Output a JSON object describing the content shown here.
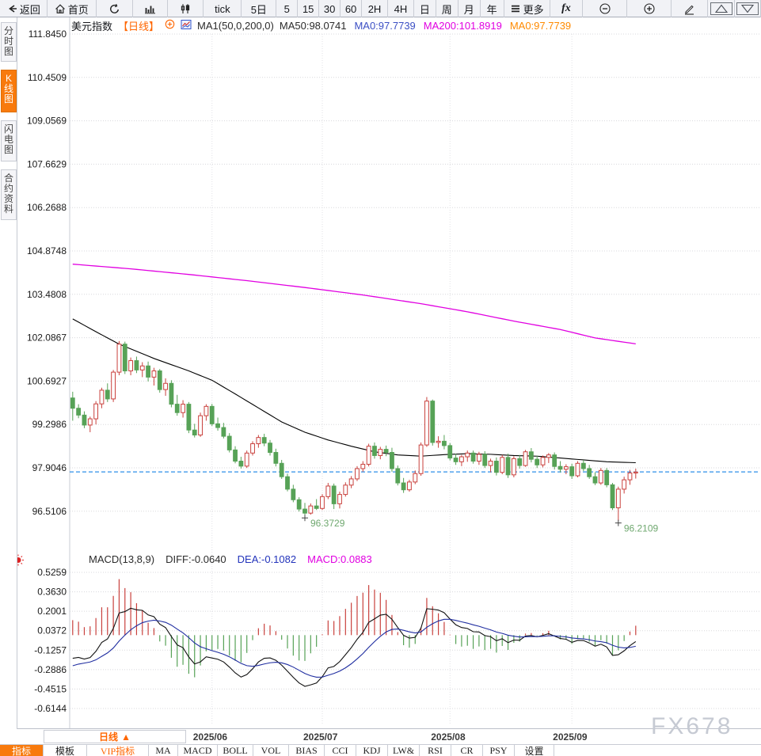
{
  "toolbar": {
    "items": [
      {
        "id": "back",
        "label": "返回",
        "icon": "back"
      },
      {
        "id": "home",
        "label": "首页",
        "icon": "home"
      },
      {
        "id": "refresh",
        "label": "",
        "icon": "refresh"
      },
      {
        "id": "line-chart",
        "label": "",
        "icon": "bar-chart"
      },
      {
        "id": "candle-chart",
        "label": "",
        "icon": "candle"
      },
      {
        "id": "tick",
        "label": "tick",
        "icon": ""
      },
      {
        "id": "5d",
        "label": "5日",
        "icon": ""
      },
      {
        "id": "m5",
        "label": "5",
        "icon": ""
      },
      {
        "id": "m15",
        "label": "15",
        "icon": ""
      },
      {
        "id": "m30",
        "label": "30",
        "icon": ""
      },
      {
        "id": "m60",
        "label": "60",
        "icon": ""
      },
      {
        "id": "h2",
        "label": "2H",
        "icon": ""
      },
      {
        "id": "h4",
        "label": "4H",
        "icon": ""
      },
      {
        "id": "day",
        "label": "日",
        "icon": ""
      },
      {
        "id": "week",
        "label": "周",
        "icon": ""
      },
      {
        "id": "month",
        "label": "月",
        "icon": ""
      },
      {
        "id": "year",
        "label": "年",
        "icon": ""
      },
      {
        "id": "more",
        "label": "更多",
        "icon": "menu"
      },
      {
        "id": "fx",
        "label": "fx",
        "icon": ""
      },
      {
        "id": "zoom-out",
        "label": "",
        "icon": "zoom-out"
      },
      {
        "id": "zoom-in",
        "label": "",
        "icon": "zoom-in"
      },
      {
        "id": "draw",
        "label": "",
        "icon": "pencil"
      },
      {
        "id": "panel-up",
        "label": "",
        "icon": "tri-up"
      },
      {
        "id": "panel-down",
        "label": "",
        "icon": "tri-down"
      }
    ]
  },
  "sidebar": {
    "items": [
      {
        "id": "time-share-chart",
        "label": "分时图",
        "active": false
      },
      {
        "id": "candlestick-chart",
        "label": "K线图",
        "active": true
      },
      {
        "id": "lightning-chart",
        "label": "闪电图",
        "active": false
      },
      {
        "id": "contract-info",
        "label": "合约资料",
        "active": false
      }
    ]
  },
  "chart_header": {
    "symbol": "美元指数",
    "period_tag": "【日线】",
    "ma_settings": "MA1(50,0,200,0)",
    "ma_values": [
      {
        "label": "MA50:98.0741",
        "color": "#2b2b2b"
      },
      {
        "label": "MA0:97.7739",
        "color": "#3b4fc4"
      },
      {
        "label": "MA200:101.8919",
        "color": "#e100e1"
      },
      {
        "label": "MA0:97.7739",
        "color": "#ff8a00"
      }
    ]
  },
  "macd_header": {
    "title": "MACD(13,8,9)",
    "values": [
      {
        "label": "DIFF:-0.0640",
        "color": "#2b2b2b"
      },
      {
        "label": "DEA:-0.1082",
        "color": "#2233bb"
      },
      {
        "label": "MACD:0.0883",
        "color": "#e100e1"
      }
    ]
  },
  "xaxis": {
    "period_label": "日线",
    "period_arrow": "▲"
  },
  "bottom_tabs": [
    {
      "id": "indicators",
      "label": "指标",
      "active": true,
      "vip": false
    },
    {
      "id": "templates",
      "label": "模板",
      "active": false,
      "vip": false
    },
    {
      "id": "vip-indicators",
      "label": "VIP指标",
      "active": false,
      "vip": true
    },
    {
      "id": "ma",
      "label": "MA",
      "active": false,
      "vip": false
    },
    {
      "id": "macd",
      "label": "MACD",
      "active": false,
      "vip": false
    },
    {
      "id": "boll",
      "label": "BOLL",
      "active": false,
      "vip": false
    },
    {
      "id": "vol",
      "label": "VOL",
      "active": false,
      "vip": false
    },
    {
      "id": "bias",
      "label": "BIAS",
      "active": false,
      "vip": false
    },
    {
      "id": "cci",
      "label": "CCI",
      "active": false,
      "vip": false
    },
    {
      "id": "kdj",
      "label": "KDJ",
      "active": false,
      "vip": false
    },
    {
      "id": "lwr",
      "label": "LW&",
      "active": false,
      "vip": false
    },
    {
      "id": "rsi",
      "label": "RSI",
      "active": false,
      "vip": false
    },
    {
      "id": "cr",
      "label": "CR",
      "active": false,
      "vip": false
    },
    {
      "id": "psy",
      "label": "PSY",
      "active": false,
      "vip": false
    },
    {
      "id": "settings",
      "label": "设置",
      "active": false,
      "vip": false
    }
  ],
  "watermark": "FX678",
  "chart_data": {
    "type": "candlestick",
    "title": "美元指数 日线",
    "y_axis": {
      "labels": [
        "111.8450",
        "110.4509",
        "109.0569",
        "107.6629",
        "106.2688",
        "104.8748",
        "103.4808",
        "102.0867",
        "100.6927",
        "99.2986",
        "97.9046",
        "96.5106"
      ]
    },
    "macd_axis": {
      "labels": [
        "0.5259",
        "0.3630",
        "0.2001",
        "0.0372",
        "-0.1257",
        "-0.2886",
        "-0.4515",
        "-0.6144"
      ]
    },
    "x_labels": [
      {
        "label": "2025/06",
        "index": 24
      },
      {
        "label": "2025/07",
        "index": 43
      },
      {
        "label": "2025/08",
        "index": 65
      },
      {
        "label": "2025/09",
        "index": 86
      }
    ],
    "current_price": 97.7739,
    "annotations": [
      {
        "index": 40,
        "price": 96.3729,
        "label": "96.3729"
      },
      {
        "index": 94,
        "price": 96.2109,
        "label": "96.2109"
      }
    ],
    "colors": {
      "up": "#c9413d",
      "down": "#57a257",
      "ma50": "#000000",
      "ma200": "#e100e1",
      "diff": "#111111",
      "dea": "#1f2da0",
      "current": "#2e8fe8",
      "annotation": "#6fa86f",
      "grid": "#d8d8dc",
      "axis_text": "#1a1a1a"
    },
    "ohlc_format": [
      "open",
      "high",
      "low",
      "close"
    ],
    "candles": [
      [
        100.15,
        100.35,
        99.42,
        99.82
      ],
      [
        99.82,
        99.95,
        99.5,
        99.6
      ],
      [
        99.6,
        99.72,
        99.18,
        99.28
      ],
      [
        99.28,
        99.55,
        99.05,
        99.48
      ],
      [
        99.48,
        100.05,
        99.3,
        99.96
      ],
      [
        99.96,
        100.48,
        99.82,
        100.4
      ],
      [
        100.4,
        100.62,
        100.02,
        100.12
      ],
      [
        100.12,
        101.05,
        100.02,
        100.98
      ],
      [
        100.98,
        101.98,
        100.88,
        101.88
      ],
      [
        101.88,
        101.96,
        100.92,
        101.02
      ],
      [
        101.02,
        101.45,
        100.88,
        101.35
      ],
      [
        101.35,
        101.48,
        100.95,
        101.05
      ],
      [
        101.05,
        101.3,
        100.82,
        101.18
      ],
      [
        101.18,
        101.32,
        100.68,
        100.82
      ],
      [
        100.82,
        101.12,
        100.55,
        101.02
      ],
      [
        101.02,
        101.08,
        100.32,
        100.42
      ],
      [
        100.42,
        100.78,
        100.22,
        100.62
      ],
      [
        100.62,
        100.72,
        99.85,
        99.95
      ],
      [
        99.95,
        100.25,
        99.58,
        99.68
      ],
      [
        99.68,
        100.08,
        99.52,
        99.95
      ],
      [
        99.95,
        100.02,
        99.02,
        99.12
      ],
      [
        99.12,
        99.32,
        98.88,
        98.96
      ],
      [
        98.96,
        99.68,
        98.9,
        99.58
      ],
      [
        99.58,
        99.95,
        99.42,
        99.88
      ],
      [
        99.88,
        99.96,
        99.25,
        99.32
      ],
      [
        99.32,
        99.52,
        99.1,
        99.2
      ],
      [
        99.2,
        99.35,
        98.85,
        98.92
      ],
      [
        98.92,
        99.02,
        98.4,
        98.48
      ],
      [
        98.48,
        98.6,
        98.05,
        98.12
      ],
      [
        98.12,
        98.26,
        97.88,
        97.96
      ],
      [
        97.96,
        98.46,
        97.9,
        98.38
      ],
      [
        98.38,
        98.76,
        98.3,
        98.68
      ],
      [
        98.68,
        98.96,
        98.55,
        98.88
      ],
      [
        98.88,
        99.0,
        98.6,
        98.7
      ],
      [
        98.7,
        98.8,
        98.3,
        98.4
      ],
      [
        98.4,
        98.52,
        97.95,
        98.05
      ],
      [
        98.05,
        98.16,
        97.55,
        97.62
      ],
      [
        97.62,
        97.72,
        97.15,
        97.22
      ],
      [
        97.22,
        97.36,
        96.8,
        96.88
      ],
      [
        96.88,
        96.96,
        96.5,
        96.58
      ],
      [
        96.58,
        96.78,
        96.3729,
        96.45
      ],
      [
        96.45,
        96.76,
        96.4,
        96.68
      ],
      [
        96.68,
        96.9,
        96.55,
        96.6
      ],
      [
        96.6,
        97.06,
        96.55,
        96.98
      ],
      [
        96.98,
        97.42,
        96.9,
        97.32
      ],
      [
        97.32,
        97.4,
        96.58,
        96.75
      ],
      [
        96.75,
        97.14,
        96.6,
        97.05
      ],
      [
        97.05,
        97.44,
        96.98,
        97.35
      ],
      [
        97.35,
        97.64,
        97.25,
        97.55
      ],
      [
        97.55,
        97.96,
        97.48,
        97.88
      ],
      [
        97.88,
        98.12,
        97.78,
        98.02
      ],
      [
        98.02,
        98.68,
        97.95,
        98.6
      ],
      [
        98.6,
        98.72,
        98.2,
        98.3
      ],
      [
        98.3,
        98.58,
        98.18,
        98.5
      ],
      [
        98.5,
        98.62,
        98.28,
        98.4
      ],
      [
        98.4,
        98.55,
        97.78,
        97.88
      ],
      [
        97.88,
        97.98,
        97.34,
        97.42
      ],
      [
        97.42,
        97.58,
        97.1,
        97.2
      ],
      [
        97.2,
        97.52,
        97.14,
        97.45
      ],
      [
        97.45,
        97.82,
        97.38,
        97.72
      ],
      [
        97.72,
        98.72,
        97.65,
        98.64
      ],
      [
        98.64,
        100.18,
        98.58,
        100.05
      ],
      [
        100.05,
        100.1,
        98.62,
        98.72
      ],
      [
        98.72,
        98.92,
        98.55,
        98.76
      ],
      [
        98.76,
        98.96,
        98.5,
        98.62
      ],
      [
        98.62,
        98.7,
        98.14,
        98.22
      ],
      [
        98.22,
        98.36,
        98.0,
        98.1
      ],
      [
        98.1,
        98.32,
        97.96,
        98.26
      ],
      [
        98.26,
        98.46,
        98.1,
        98.38
      ],
      [
        98.38,
        98.46,
        98.04,
        98.12
      ],
      [
        98.12,
        98.42,
        98.0,
        98.34
      ],
      [
        98.34,
        98.44,
        97.9,
        97.98
      ],
      [
        97.98,
        98.2,
        97.76,
        98.12
      ],
      [
        98.12,
        98.24,
        97.66,
        97.76
      ],
      [
        97.76,
        98.32,
        97.7,
        98.24
      ],
      [
        98.24,
        98.36,
        97.58,
        97.68
      ],
      [
        97.68,
        98.28,
        97.6,
        98.2
      ],
      [
        98.2,
        98.32,
        97.88,
        97.98
      ],
      [
        97.98,
        98.48,
        97.94,
        98.42
      ],
      [
        98.42,
        98.54,
        98.08,
        98.18
      ],
      [
        98.18,
        98.3,
        97.9,
        98.0
      ],
      [
        98.0,
        98.3,
        97.92,
        98.24
      ],
      [
        98.24,
        98.38,
        98.06,
        98.32
      ],
      [
        98.32,
        98.4,
        97.85,
        97.95
      ],
      [
        97.95,
        98.12,
        97.76,
        97.86
      ],
      [
        97.86,
        98.02,
        97.7,
        97.94
      ],
      [
        97.94,
        98.04,
        97.55,
        97.65
      ],
      [
        97.65,
        98.12,
        97.6,
        98.05
      ],
      [
        98.05,
        98.16,
        97.8,
        97.88
      ],
      [
        97.88,
        98.0,
        97.55,
        97.62
      ],
      [
        97.62,
        97.76,
        97.35,
        97.42
      ],
      [
        97.42,
        97.9,
        97.36,
        97.82
      ],
      [
        97.82,
        97.9,
        97.28,
        97.36
      ],
      [
        97.36,
        97.42,
        96.55,
        96.62
      ],
      [
        96.62,
        97.3,
        96.21,
        97.22
      ],
      [
        97.22,
        97.62,
        97.08,
        97.52
      ],
      [
        97.52,
        97.84,
        97.36,
        97.74
      ],
      [
        97.74,
        97.88,
        97.56,
        97.77
      ]
    ],
    "ma50_anchors": [
      [
        0,
        102.69
      ],
      [
        4,
        102.28
      ],
      [
        8,
        101.88
      ],
      [
        14,
        101.42
      ],
      [
        20,
        101.02
      ],
      [
        24,
        100.72
      ],
      [
        28,
        100.28
      ],
      [
        32,
        99.83
      ],
      [
        36,
        99.38
      ],
      [
        40,
        99.05
      ],
      [
        44,
        98.8
      ],
      [
        48,
        98.6
      ],
      [
        52,
        98.42
      ],
      [
        56,
        98.32
      ],
      [
        60,
        98.28
      ],
      [
        64,
        98.33
      ],
      [
        68,
        98.36
      ],
      [
        72,
        98.34
      ],
      [
        76,
        98.3
      ],
      [
        80,
        98.28
      ],
      [
        84,
        98.22
      ],
      [
        88,
        98.16
      ],
      [
        92,
        98.1
      ],
      [
        97,
        98.07
      ]
    ],
    "ma200_anchors": [
      [
        0,
        104.45
      ],
      [
        10,
        104.3
      ],
      [
        20,
        104.12
      ],
      [
        30,
        103.92
      ],
      [
        40,
        103.7
      ],
      [
        50,
        103.46
      ],
      [
        60,
        103.18
      ],
      [
        68,
        102.92
      ],
      [
        76,
        102.62
      ],
      [
        84,
        102.35
      ],
      [
        90,
        102.08
      ],
      [
        94,
        101.97
      ],
      [
        97,
        101.89
      ]
    ],
    "macd_params": [
      13,
      8,
      9
    ],
    "macd_warmup_closes": [
      101.9,
      101.7,
      101.5,
      101.3,
      101.1,
      100.9,
      100.7,
      100.5,
      100.3,
      100.1,
      99.9,
      99.7,
      99.6,
      99.5,
      99.4,
      99.6,
      99.8,
      100.0
    ]
  }
}
